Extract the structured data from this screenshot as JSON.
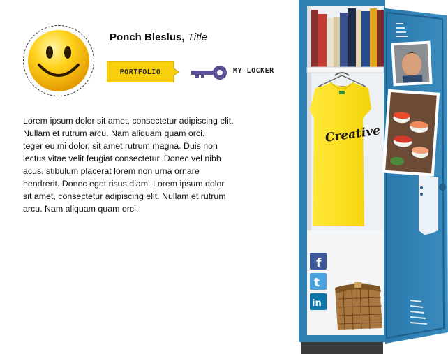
{
  "profile": {
    "name": "Ponch Bleslus,",
    "title": "Title"
  },
  "nav": {
    "portfolio_label": "PORTFOLIO",
    "locker_label": "MY LOCKER"
  },
  "bio_text": "Lorem ipsum dolor sit amet, consectetur adipiscing elit.\nNullam et rutrum arcu. Nam aliquam quam orci.\nteger eu mi dolor, sit amet rutrum magna. Duis non\nlectus vitae velit feugiat consectetur. Donec vel nibh\nacus. stibulum placerat lorem non urna ornare\n hendrerit. Donec eget risus diam. Lorem ipsum dolor\nsit amet, consectetur adipiscing elit. Nullam et rutrum\narcu. Nam aliquam quam orci.",
  "locker": {
    "shirt_text": "Creative",
    "shirt_tag": "M"
  },
  "social": {
    "facebook": "f",
    "twitter": "t",
    "linkedin": "in"
  },
  "colors": {
    "accent_yellow": "#f7cf0a",
    "key_purple": "#5c4f95",
    "locker_blue": "#2f7fb1",
    "locker_dark": "#1f5f8a"
  },
  "icons": {
    "avatar": "smiley-face-icon",
    "key": "key-icon",
    "facebook": "facebook-icon",
    "twitter": "twitter-icon",
    "linkedin": "linkedin-icon"
  }
}
